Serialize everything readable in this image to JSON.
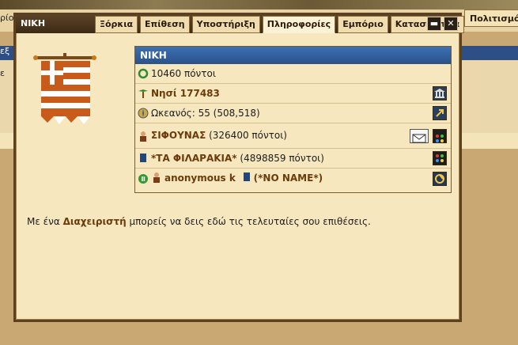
{
  "background": {
    "left_snippets": [
      "ρίο",
      "εξ",
      "ε"
    ],
    "right_button": "Πολιτισμός"
  },
  "window": {
    "title": "ΝΙΚΗ",
    "tabs": [
      {
        "label": "Ξόρκια"
      },
      {
        "label": "Επίθεση"
      },
      {
        "label": "Υποστήριξη"
      },
      {
        "label": "Πληροφορίες",
        "active": true
      },
      {
        "label": "Εμπόριο"
      },
      {
        "label": "Κατασκοπεία"
      }
    ],
    "minimize_label": "▬",
    "close_label": "✕"
  },
  "panel": {
    "header": "ΝΙΚΗ",
    "points": "10460 πόντοι",
    "island": "Νησί 177483",
    "ocean": "Ωκεανός: 55 (508,518)",
    "player_name": "ΣΙΦΟΥΝΑΣ",
    "player_points": " (326400 πόντοι)",
    "alliance_name": "*ΤΑ ΦΙΛΑΡΑΚΙΑ*",
    "alliance_points": " (4898859 πόντοι)",
    "owner_name": "anonymous k",
    "owner_alliance": "(*NO NAME*)"
  },
  "message": {
    "prefix": "Με ένα ",
    "link": "Διαχειριστή",
    "suffix": " μπορείς να δεις εδώ τις τελευταίες σου επιθέσεις."
  },
  "colors": {
    "accent_blue": "#2a528a",
    "window_bg": "#f6e7bf",
    "frame_brown": "#5b4120",
    "link_brown": "#6b3b0b"
  }
}
